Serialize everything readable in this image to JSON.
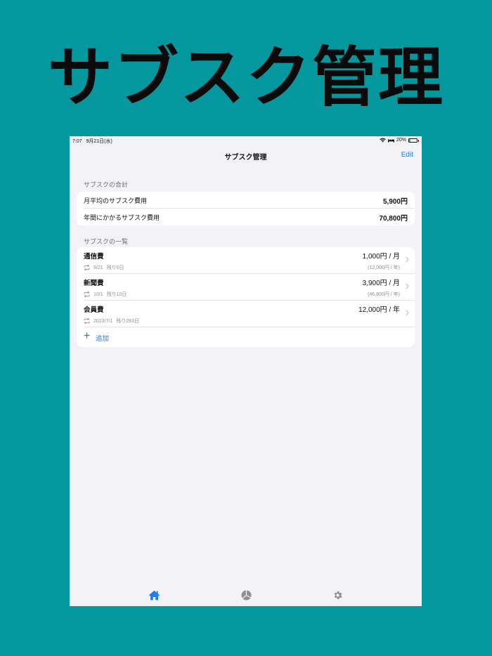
{
  "hero": {
    "title": "サブスク管理"
  },
  "status_bar": {
    "time": "7:07",
    "date": "9月21日(水)",
    "battery": "20%",
    "battery_level": 0.2
  },
  "nav": {
    "title": "サブスク管理",
    "edit_label": "Edit"
  },
  "summary": {
    "header": "サブスクの合計",
    "rows": [
      {
        "label": "月平均のサブスク費用",
        "value": "5,900円"
      },
      {
        "label": "年間にかかるサブスク費用",
        "value": "70,800円"
      }
    ]
  },
  "subscriptions": {
    "header": "サブスクの一覧",
    "items": [
      {
        "name": "通信費",
        "price": "1,000円 / 月",
        "date": "9/21",
        "remaining": "残り0日",
        "annual": "(12,000円 / 年)"
      },
      {
        "name": "新聞費",
        "price": "3,900円 / 月",
        "date": "10/1",
        "remaining": "残り10日",
        "annual": "(46,800円 / 年)"
      },
      {
        "name": "会員費",
        "price": "12,000円 / 年",
        "date": "2023/7/1",
        "remaining": "残り283日",
        "annual": ""
      }
    ],
    "add_label": "追加"
  },
  "tabbar": {
    "tabs": [
      {
        "icon": "house-icon",
        "active": true
      },
      {
        "icon": "pie-chart-icon",
        "active": false
      },
      {
        "icon": "gear-icon",
        "active": false
      }
    ]
  },
  "colors": {
    "background": "#04989e",
    "accent": "#1e7cf5",
    "secondary_text": "#8e8e93"
  }
}
